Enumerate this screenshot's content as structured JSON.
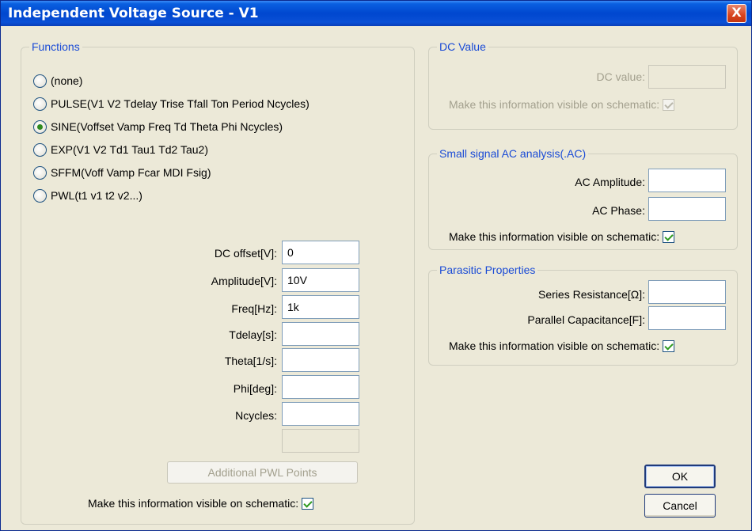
{
  "window": {
    "title": "Independent Voltage Source - V1",
    "close_label": "X"
  },
  "functions": {
    "legend": "Functions",
    "options": [
      {
        "label": "(none)",
        "checked": false
      },
      {
        "label": "PULSE(V1 V2 Tdelay Trise Tfall Ton Period Ncycles)",
        "checked": false
      },
      {
        "label": "SINE(Voffset Vamp Freq Td Theta Phi Ncycles)",
        "checked": true
      },
      {
        "label": "EXP(V1 V2 Td1 Tau1 Td2 Tau2)",
        "checked": false
      },
      {
        "label": "SFFM(Voff Vamp Fcar MDI Fsig)",
        "checked": false
      },
      {
        "label": "PWL(t1 v1 t2 v2...)",
        "checked": false
      }
    ],
    "fields": [
      {
        "label": "DC offset[V]:",
        "value": "0"
      },
      {
        "label": "Amplitude[V]:",
        "value": "10V"
      },
      {
        "label": "Freq[Hz]:",
        "value": "1k"
      },
      {
        "label": "Tdelay[s]:",
        "value": ""
      },
      {
        "label": "Theta[1/s]:",
        "value": ""
      },
      {
        "label": "Phi[deg]:",
        "value": ""
      },
      {
        "label": "Ncycles:",
        "value": ""
      }
    ],
    "extra_field_value": "",
    "pwl_button": "Additional PWL Points",
    "visible_label": "Make this information visible on schematic:",
    "visible_checked": true
  },
  "dc_value": {
    "legend": "DC Value",
    "field_label": "DC value:",
    "field_value": "",
    "visible_label": "Make this information visible on schematic:",
    "visible_checked": true
  },
  "ac": {
    "legend": "Small signal AC analysis(.AC)",
    "amplitude_label": "AC Amplitude:",
    "amplitude_value": "",
    "phase_label": "AC Phase:",
    "phase_value": "",
    "visible_label": "Make this information visible on schematic:",
    "visible_checked": true
  },
  "parasitic": {
    "legend": "Parasitic Properties",
    "resistance_label": "Series Resistance[Ω]:",
    "resistance_value": "",
    "capacitance_label": "Parallel Capacitance[F]:",
    "capacitance_value": "",
    "visible_label": "Make this information visible on schematic:",
    "visible_checked": true
  },
  "buttons": {
    "ok": "OK",
    "cancel": "Cancel"
  }
}
